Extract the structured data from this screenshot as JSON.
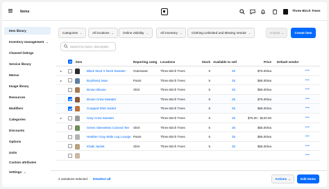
{
  "app": {
    "title": "Items",
    "user_name": "Three Birch Trees"
  },
  "colors": {
    "accent": "#006aff",
    "brand": "#111111"
  },
  "topbar_icons": [
    "search-icon",
    "chat-icon",
    "bell-icon",
    "clipboard-icon",
    "help-icon"
  ],
  "sidebar": {
    "items": [
      {
        "label": "Item library",
        "active": true
      },
      {
        "label": "Inventory management",
        "caret": "⌄"
      },
      {
        "label": "Channel listings"
      },
      {
        "label": "Service library"
      },
      {
        "label": "Menus"
      },
      {
        "label": "Image library"
      },
      {
        "label": "Resources"
      },
      {
        "label": "Modifiers"
      },
      {
        "label": "Categories"
      },
      {
        "label": "Discounts"
      },
      {
        "label": "Options"
      },
      {
        "label": "Units"
      },
      {
        "label": "Custom attributes"
      },
      {
        "label": "Settings",
        "caret": "⌄"
      }
    ]
  },
  "filters": {
    "categories": "Categories",
    "locations": "All locations",
    "visibility": "Online visibility",
    "inventory": "All inventory",
    "vendor": "Clothing Unlimited and Missing Vendor",
    "caret": "⌄"
  },
  "toolbar": {
    "actions_label": "Actions",
    "create_label": "Create item",
    "caret": "⌄"
  },
  "search": {
    "placeholder": "Search by name, description"
  },
  "table": {
    "headers": {
      "item": "Item",
      "category": "Reporting categ",
      "locations": "Locations",
      "stock": "Stock",
      "available": "Available to sell",
      "price": "Price",
      "vendor": "Default vendor"
    },
    "more_glyph": "•••",
    "rows": [
      {
        "name": "Black Wool V Neck Sweater",
        "category": "Outerwear",
        "location": "Three Birch Trees",
        "stock": "5",
        "available": "25",
        "price": "$75.00/ea",
        "expand": true,
        "checked": false,
        "thumb_color": "#2b2b2b"
      },
      {
        "name": "Boyfriend Jean",
        "category": "Pants",
        "location": "Three Birch Trees",
        "stock": "5",
        "available": "25",
        "price": "$65.00/ea",
        "expand": true,
        "checked": false,
        "thumb_color": "#5d7fa6"
      },
      {
        "name": "Brown Blouse",
        "category": "Shirt",
        "location": "Three Birch Trees",
        "stock": "5",
        "available": "25",
        "price": "$55.00/ea",
        "expand": false,
        "checked": false,
        "thumb_color": "#a87a52"
      },
      {
        "name": "Brown Crew Sweater",
        "category": "",
        "location": "Three Birch Trees",
        "stock": "5",
        "available": "25",
        "price": "$75.00/ea",
        "expand": false,
        "checked": true,
        "thumb_color": "#8a5a3c"
      },
      {
        "name": "Cropped Shirt Jacket",
        "category": "",
        "location": "Three Birch Trees",
        "stock": "5",
        "available": "25",
        "price": "$65.00/ea",
        "expand": false,
        "checked": true,
        "thumb_color": "#b9733f"
      },
      {
        "name": "Gray Crew Sweater",
        "category": "",
        "location": "Three Birch Trees",
        "stock": "5",
        "available": "25",
        "price": "$75.00 - $120.00",
        "expand": true,
        "checked": false,
        "thumb_color": "#9a9a9a"
      },
      {
        "name": "Green Sleeveless Colored Tee",
        "category": "Shirt",
        "location": "Three Birch Trees",
        "stock": "5",
        "available": "25",
        "price": "$55.00/ea",
        "expand": false,
        "checked": false,
        "thumb_color": "#6f8c5a"
      },
      {
        "name": "Heather Gray Wide Leg Lounge",
        "category": "Pants",
        "location": "Three Birch Trees",
        "stock": "5",
        "available": "25",
        "price": "$65.00/ea",
        "expand": false,
        "checked": false,
        "thumb_color": "#b4b4b4"
      },
      {
        "name": "Khaki Jacket",
        "category": "Shirt",
        "location": "Three Birch Trees",
        "stock": "5",
        "available": "25",
        "price": "$55.00/ea",
        "expand": false,
        "checked": false,
        "thumb_color": "#b7a27a"
      },
      {
        "name": "",
        "category": "",
        "location": "",
        "stock": "",
        "available": "",
        "price": "",
        "expand": false,
        "checked": false,
        "thumb_color": "#c9b8a0"
      }
    ]
  },
  "footer": {
    "selected_text": "2 variations selected",
    "deselect_label": "Deselect all",
    "actions_label": "Actions",
    "edit_label": "Edit items",
    "caret": "⌄"
  }
}
